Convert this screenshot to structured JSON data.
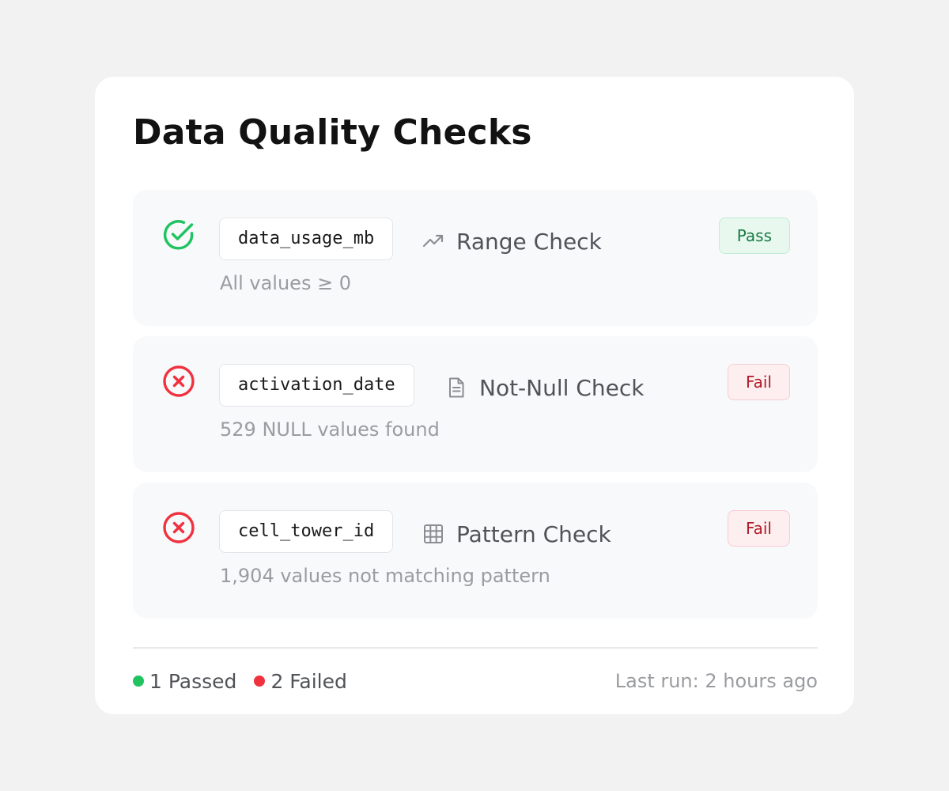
{
  "title": "Data Quality Checks",
  "colors": {
    "pass": "#1fc35f",
    "fail": "#f0323f"
  },
  "checks": [
    {
      "status": "pass",
      "status_icon": "check-circle-icon",
      "column": "data_usage_mb",
      "type_icon": "trending-up-icon",
      "type": "Range Check",
      "badge": "Pass",
      "detail": "All values ≥ 0"
    },
    {
      "status": "fail",
      "status_icon": "x-circle-icon",
      "column": "activation_date",
      "type_icon": "document-icon",
      "type": "Not-Null Check",
      "badge": "Fail",
      "detail": "529 NULL values found"
    },
    {
      "status": "fail",
      "status_icon": "x-circle-icon",
      "column": "cell_tower_id",
      "type_icon": "grid-icon",
      "type": "Pattern Check",
      "badge": "Fail",
      "detail": "1,904 values not matching pattern"
    }
  ],
  "footer": {
    "passed": "1 Passed",
    "failed": "2 Failed",
    "last_run": "Last run: 2 hours ago"
  }
}
